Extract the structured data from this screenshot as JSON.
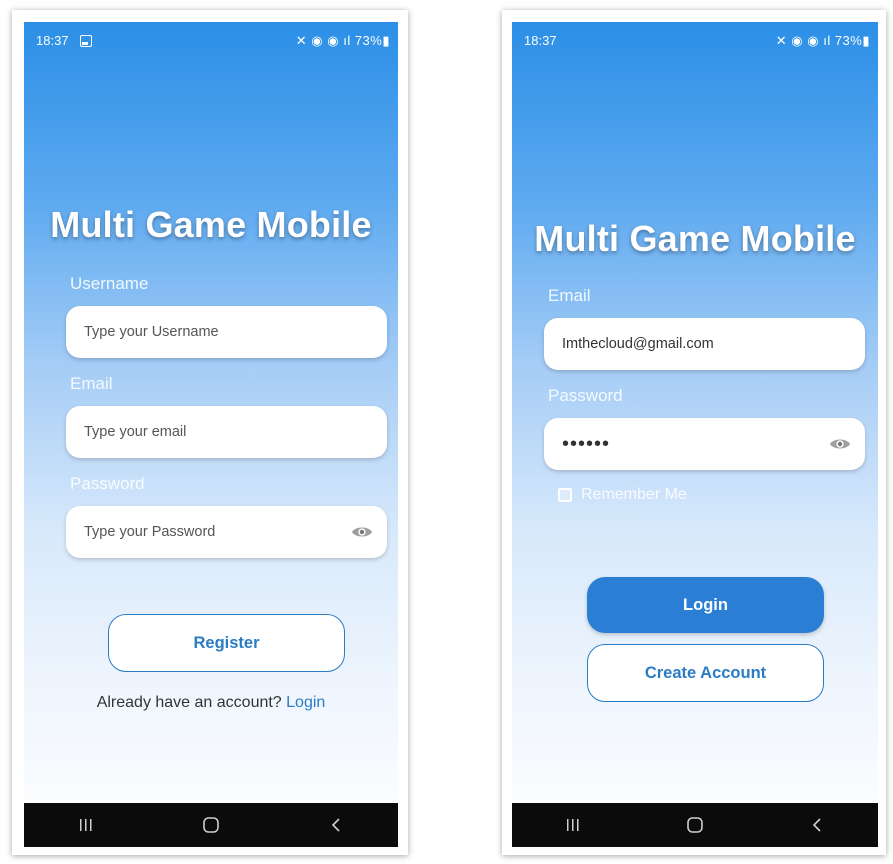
{
  "app_title": "Multi Game Mobile",
  "register_screen": {
    "status_time": "18:37",
    "status_right": "✕ ◉ ◉ ıl 73%▮",
    "username_label": "Username",
    "username_placeholder": "Type your Username",
    "email_label": "Email",
    "email_placeholder": "Type your email",
    "password_label": "Password",
    "password_placeholder": "Type your Password",
    "register_button": "Register",
    "already_text": "Already have an account? ",
    "login_link": "Login"
  },
  "login_screen": {
    "status_time": "18:37",
    "status_right": "✕ ◉ ◉ ıl 73%▮",
    "email_label": "Email",
    "email_value": "Imthecloud@gmail.com",
    "password_label": "Password",
    "password_value": "••••••",
    "remember_label": "Remember Me",
    "login_button": "Login",
    "create_account_button": "Create Account"
  },
  "icons": {
    "password_toggle": "eye-icon",
    "nav_recent": "recent-apps-icon",
    "nav_home": "home-icon",
    "nav_back": "back-icon"
  },
  "colors": {
    "accent": "#2a7fd4",
    "link": "#2b7cc4",
    "gradient_top": "#2b8fe6",
    "nav_bar": "#0b0b0b"
  }
}
